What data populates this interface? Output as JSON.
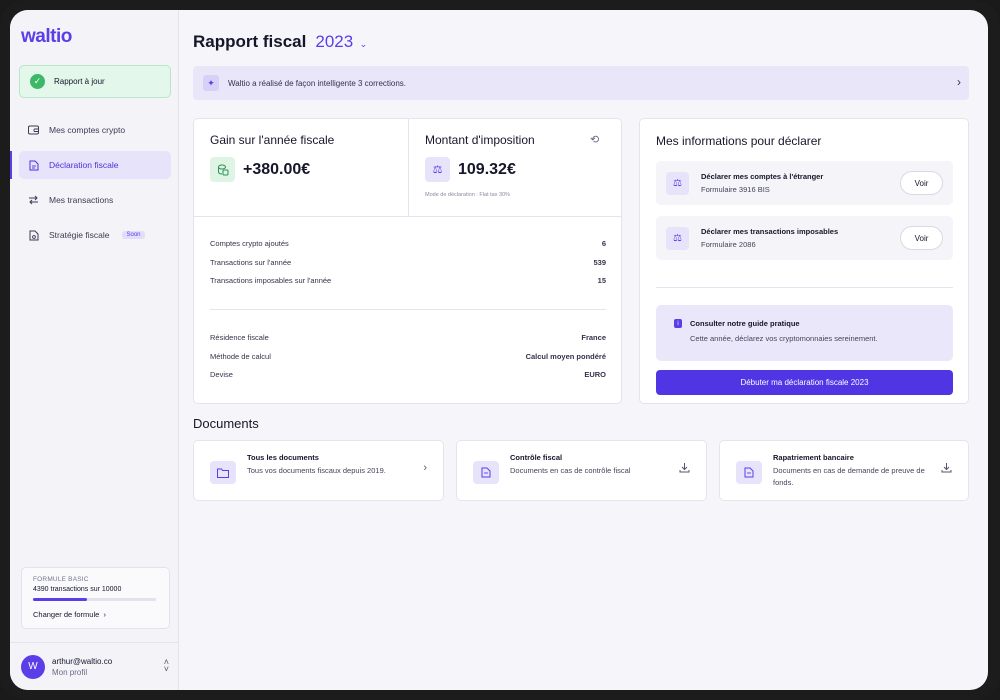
{
  "app": {
    "logo": "waltio"
  },
  "sidebar": {
    "status": "Rapport à jour",
    "items": [
      {
        "label": "Mes comptes crypto",
        "icon": "wallet-icon",
        "active": false
      },
      {
        "label": "Déclaration fiscale",
        "icon": "document-icon",
        "active": true
      },
      {
        "label": "Mes transactions",
        "icon": "swap-arrows-icon",
        "active": false
      },
      {
        "label": "Stratégie fiscale",
        "icon": "strategy-icon",
        "active": false,
        "badge": "Soon"
      }
    ],
    "plan": {
      "title": "FORMULE BASIC",
      "usage": "4390 transactions sur 10000",
      "usage_ratio": 0.439,
      "link": "Changer de formule"
    },
    "profile": {
      "initial": "W",
      "email": "arthur@waltio.co",
      "subtitle": "Mon profil"
    }
  },
  "header": {
    "title": "Rapport fiscal",
    "year": "2023"
  },
  "banner": {
    "text": "Waltio a réalisé de façon intelligente 3 corrections."
  },
  "summary": {
    "gain": {
      "title": "Gain sur l'année fiscale",
      "value": "+380.00€"
    },
    "tax": {
      "title": "Montant d'imposition",
      "value": "109.32€",
      "note": "Mode de déclaration : Flat tax 30%"
    },
    "stats": [
      {
        "label": "Comptes crypto ajoutés",
        "value": "6"
      },
      {
        "label": "Transactions sur l'année",
        "value": "539"
      },
      {
        "label": "Transactions imposables sur l'année",
        "value": "15"
      }
    ],
    "settings": [
      {
        "label": "Résidence fiscale",
        "value": "France"
      },
      {
        "label": "Méthode de calcul",
        "value": "Calcul moyen pondéré"
      },
      {
        "label": "Devise",
        "value": "EURO"
      }
    ]
  },
  "info": {
    "title": "Mes informations pour déclarer",
    "items": [
      {
        "title": "Déclarer mes comptes à l'étranger",
        "subtitle": "Formulaire 3916 BIS",
        "button": "Voir"
      },
      {
        "title": "Déclarer mes transactions imposables",
        "subtitle": "Formulaire 2086",
        "button": "Voir"
      }
    ],
    "guide": {
      "title": "Consulter notre guide pratique",
      "subtitle": "Cette année, déclarez vos cryptomonnaies sereinement."
    },
    "cta": "Débuter ma déclaration fiscale 2023"
  },
  "documents": {
    "title": "Documents",
    "items": [
      {
        "title": "Tous les documents",
        "subtitle": "Tous vos documents fiscaux depuis 2019.",
        "action": "chevron-right-icon"
      },
      {
        "title": "Contrôle fiscal",
        "subtitle": "Documents en cas de contrôle fiscal",
        "action": "download-icon"
      },
      {
        "title": "Rapatriement bancaire",
        "subtitle": "Documents en cas de demande de preuve de fonds.",
        "action": "download-icon"
      }
    ]
  },
  "colors": {
    "accent": "#5b3ee8",
    "success": "#3cb866",
    "banner_bg": "#e9e6fa"
  }
}
